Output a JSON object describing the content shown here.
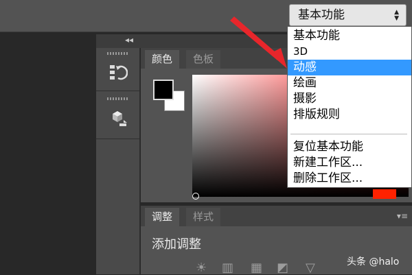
{
  "topbar": {
    "workspace_selected": "基本功能",
    "caret_icon": "updown-caret-icon"
  },
  "toolstrip": {
    "collapse_icon": "double-chevron-left-icon",
    "tools": [
      {
        "icon": "history-icon"
      },
      {
        "icon": "3d-cube-icon"
      }
    ]
  },
  "color_panel": {
    "tabs": [
      {
        "label": "颜色",
        "active": true
      },
      {
        "label": "色板",
        "active": false
      }
    ],
    "foreground": "#000000",
    "background": "#ffffff",
    "hue_color": "#ff2200"
  },
  "adjust_panel": {
    "tabs": [
      {
        "label": "调整",
        "active": true
      },
      {
        "label": "样式",
        "active": false
      }
    ],
    "title": "添加调整",
    "icons": [
      "brightness-icon",
      "levels-icon",
      "curves-icon",
      "exposure-icon",
      "vibrance-icon"
    ]
  },
  "workspace_menu": {
    "items": [
      {
        "label": "基本功能",
        "selected": false
      },
      {
        "label": "3D",
        "selected": false
      },
      {
        "label": "动感",
        "selected": true
      },
      {
        "label": "绘画",
        "selected": false
      },
      {
        "label": "摄影",
        "selected": false
      },
      {
        "label": "排版规则",
        "selected": false
      },
      {
        "label": "复位基本功能",
        "selected": false
      },
      {
        "label": "新建工作区...",
        "selected": false
      },
      {
        "label": "删除工作区...",
        "selected": false
      }
    ],
    "highlight_color": "#3399ff"
  },
  "annotation": {
    "arrow_color": "#e8262b"
  },
  "watermark": "头条 @halo"
}
